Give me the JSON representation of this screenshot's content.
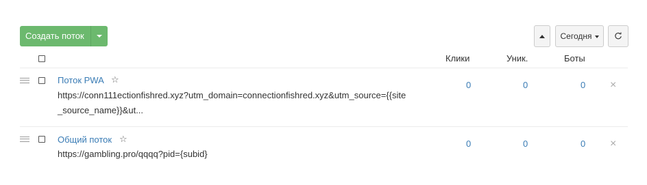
{
  "toolbar": {
    "create_label": "Создать поток",
    "date_label": "Сегодня",
    "icons": {
      "caret": "chevron-down-icon",
      "sort": "chevron-up-icon",
      "refresh": "refresh-icon"
    }
  },
  "table": {
    "columns": [
      "Клики",
      "Уник.",
      "Боты"
    ],
    "rows": [
      {
        "name": "Поток PWA",
        "url_line1": "https://conn111ectionfishred.xyz?utm_domain=connectionfishred.xyz&utm_source={{site",
        "url_line2": "_source_name}}&ut...",
        "clicks": "0",
        "unique": "0",
        "bots": "0"
      },
      {
        "name": "Общий поток",
        "url_line1": "https://gambling.pro/qqqq?pid={subid}",
        "clicks": "0",
        "unique": "0",
        "bots": "0"
      }
    ]
  },
  "colors": {
    "accent_green": "#6cb96e",
    "link_blue": "#3a7cb5"
  }
}
